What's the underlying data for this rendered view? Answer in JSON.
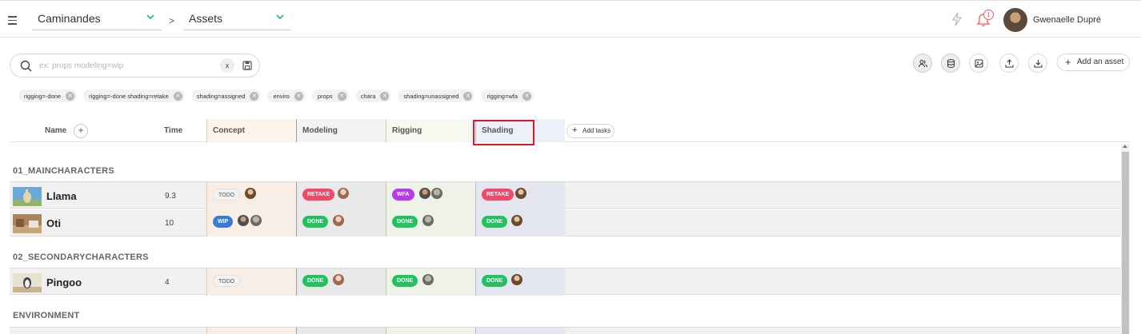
{
  "header": {
    "production": "Caminandes",
    "separator": ">",
    "section": "Assets",
    "notification_count": "1",
    "user_name": "Gwenaelle Dupré"
  },
  "search": {
    "placeholder": "ex: props modeling=wip",
    "clear_label": "x"
  },
  "toolbar": {
    "add_asset_label": "Add an asset",
    "icons": [
      "people-icon",
      "database-icon",
      "image-icon",
      "upload-icon",
      "download-icon"
    ]
  },
  "filters": [
    "rigging=-done",
    "rigging=-done shading=retake",
    "shading=assigned",
    "enviro",
    "props",
    "chara",
    "shading=unassigned",
    "rigging=wfa"
  ],
  "table": {
    "columns": {
      "name": "Name",
      "time": "Time",
      "concept": "Concept",
      "modeling": "Modeling",
      "rigging": "Rigging",
      "shading": "Shading"
    },
    "add_tasks_label": "Add tasks",
    "groups": [
      {
        "title": "01_MAINCHARACTERS",
        "rows": [
          {
            "name": "Llama",
            "time": "9.3",
            "concept": "TODO",
            "modeling": "RETAKE",
            "rigging": "WFA",
            "shading": "RETAKE"
          },
          {
            "name": "Oti",
            "time": "10",
            "concept": "WIP",
            "modeling": "DONE",
            "rigging": "DONE",
            "shading": "DONE"
          }
        ]
      },
      {
        "title": "02_SECONDARYCHARACTERS",
        "rows": [
          {
            "name": "Pingoo",
            "time": "4",
            "concept": "TODO",
            "modeling": "DONE",
            "rigging": "DONE",
            "shading": "DONE"
          }
        ]
      },
      {
        "title": "ENVIRONMENT",
        "rows": []
      }
    ]
  },
  "colors": {
    "todo": "#f3f3f3",
    "retake": "#f24968",
    "done": "#22c35e",
    "wip": "#3a7bd5",
    "wfa": "#b73bea",
    "highlight": "#d2202a"
  }
}
